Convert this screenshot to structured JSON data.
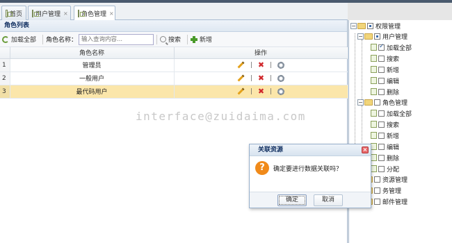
{
  "tabs": [
    {
      "label": "首页",
      "closable": false
    },
    {
      "label": "用户管理",
      "closable": true
    },
    {
      "label": "角色管理",
      "closable": true,
      "active": true
    }
  ],
  "panel": {
    "title": "角色列表"
  },
  "toolbar": {
    "load_all_label": "加载全部",
    "role_name_label": "角色名称：",
    "search_placeholder": "输入查询内容...",
    "search_label": "搜索",
    "add_label": "新增"
  },
  "grid": {
    "col_name": "角色名称",
    "col_ops": "操作",
    "rows": [
      {
        "num": "1",
        "name": "管理员"
      },
      {
        "num": "2",
        "name": "一般用户"
      },
      {
        "num": "3",
        "name": "最代码用户",
        "selected": true
      }
    ],
    "op_separator": "|"
  },
  "watermark": "interface@zuidaima.com",
  "tree": {
    "root": "权限管理",
    "user_mgmt": "用户管理",
    "user_items": [
      "加载全部",
      "搜索",
      "新增",
      "编辑",
      "删除"
    ],
    "role_mgmt": "角色管理",
    "role_items": [
      "加载全部",
      "搜索",
      "新增",
      "编辑",
      "删除",
      "分配"
    ],
    "resource_mgmt": "资源管理",
    "task_mgmt": "务管理",
    "mail_mgmt": "邮件管理"
  },
  "dialog": {
    "title": "关联资源",
    "message": "确定要进行数据关联吗？",
    "ok_label": "确定",
    "cancel_label": "取消"
  },
  "colors": {
    "selected_row": "#fbe6aa",
    "question_icon": "#f08a1a"
  }
}
